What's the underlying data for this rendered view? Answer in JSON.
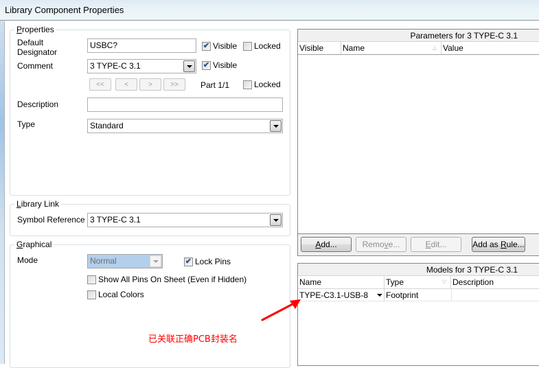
{
  "window": {
    "title": "Library Component Properties"
  },
  "properties": {
    "legend": "Properties",
    "default_designator": {
      "label_line1": "Default",
      "label_line2": "Designator",
      "value": "USBC?",
      "visible_label": "Visible",
      "visible_checked": true,
      "locked_label": "Locked",
      "locked_checked": false
    },
    "comment": {
      "label": "Comment",
      "value": "3 TYPE-C 3.1",
      "visible_label": "Visible",
      "visible_checked": true
    },
    "part_nav": {
      "first": "<<",
      "prev": "<",
      "next": ">",
      "last": ">>",
      "part_text": "Part 1/1",
      "locked_label": "Locked",
      "locked_checked": false
    },
    "description": {
      "label": "Description",
      "value": ""
    },
    "type": {
      "label": "Type",
      "value": "Standard"
    }
  },
  "library_link": {
    "legend": "Library Link",
    "symbol_reference": {
      "label": "Symbol Reference",
      "value": "3 TYPE-C 3.1"
    }
  },
  "graphical": {
    "legend": "Graphical",
    "mode": {
      "label": "Mode",
      "value": "Normal"
    },
    "lock_pins": {
      "label": "Lock Pins",
      "checked": true
    },
    "show_all_pins": {
      "label": "Show All Pins On Sheet (Even if Hidden)",
      "checked": false
    },
    "local_colors": {
      "label": "Local Colors",
      "checked": false
    }
  },
  "parameters": {
    "title": "Parameters for 3 TYPE-C 3.1",
    "columns": [
      "Visible",
      "Name",
      "Value"
    ],
    "rows": [],
    "buttons": {
      "add": "Add...",
      "remove": "Remove...",
      "edit": "Edit...",
      "add_as_rule": "Add as Rule..."
    }
  },
  "models": {
    "title": "Models for 3 TYPE-C 3.1",
    "columns": [
      "Name",
      "Type",
      "Description"
    ],
    "rows": [
      {
        "name": "TYPE-C3.1-USB-8",
        "type": "Footprint",
        "description": ""
      }
    ]
  },
  "annotation": {
    "text": "已关联正确PCB封装名",
    "color": "#ff0000"
  },
  "check_mark": "✔"
}
